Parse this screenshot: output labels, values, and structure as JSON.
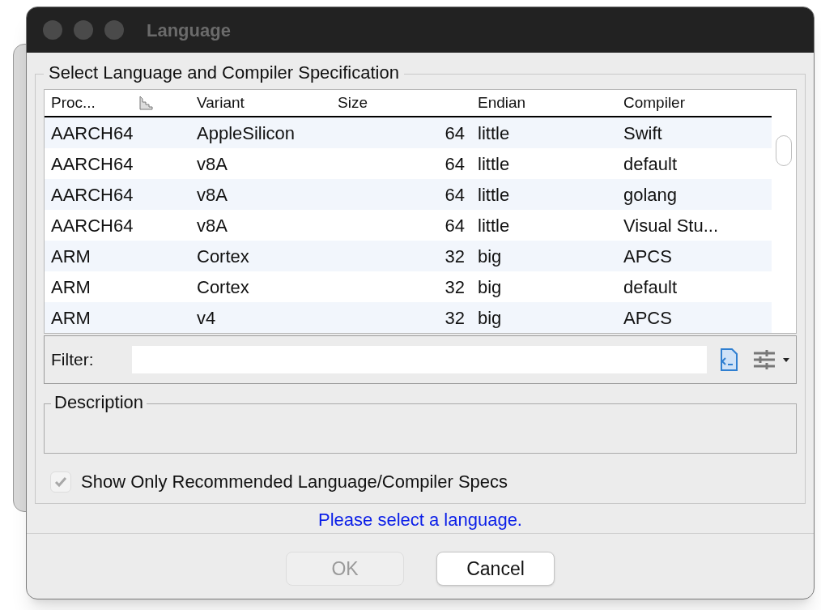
{
  "window": {
    "title": "Language"
  },
  "group_title": "Select Language and Compiler Specification",
  "table": {
    "columns": [
      "Proc...",
      "Variant",
      "Size",
      "Endian",
      "Compiler"
    ],
    "rows": [
      [
        "AARCH64",
        "AppleSilicon",
        "64",
        "little",
        "Swift"
      ],
      [
        "AARCH64",
        "v8A",
        "64",
        "little",
        "default"
      ],
      [
        "AARCH64",
        "v8A",
        "64",
        "little",
        "golang"
      ],
      [
        "AARCH64",
        "v8A",
        "64",
        "little",
        "Visual Stu..."
      ],
      [
        "ARM",
        "Cortex",
        "32",
        "big",
        "APCS"
      ],
      [
        "ARM",
        "Cortex",
        "32",
        "big",
        "default"
      ],
      [
        "ARM",
        "v4",
        "32",
        "big",
        "APCS"
      ]
    ]
  },
  "filter": {
    "label": "Filter:"
  },
  "description": {
    "title": "Description"
  },
  "recommended": {
    "label": "Show Only Recommended Language/Compiler Specs",
    "checked": true,
    "disabled": true
  },
  "status": "Please select a language.",
  "buttons": [
    {
      "label": "OK",
      "disabled": true
    },
    {
      "label": "Cancel",
      "disabled": false
    }
  ]
}
